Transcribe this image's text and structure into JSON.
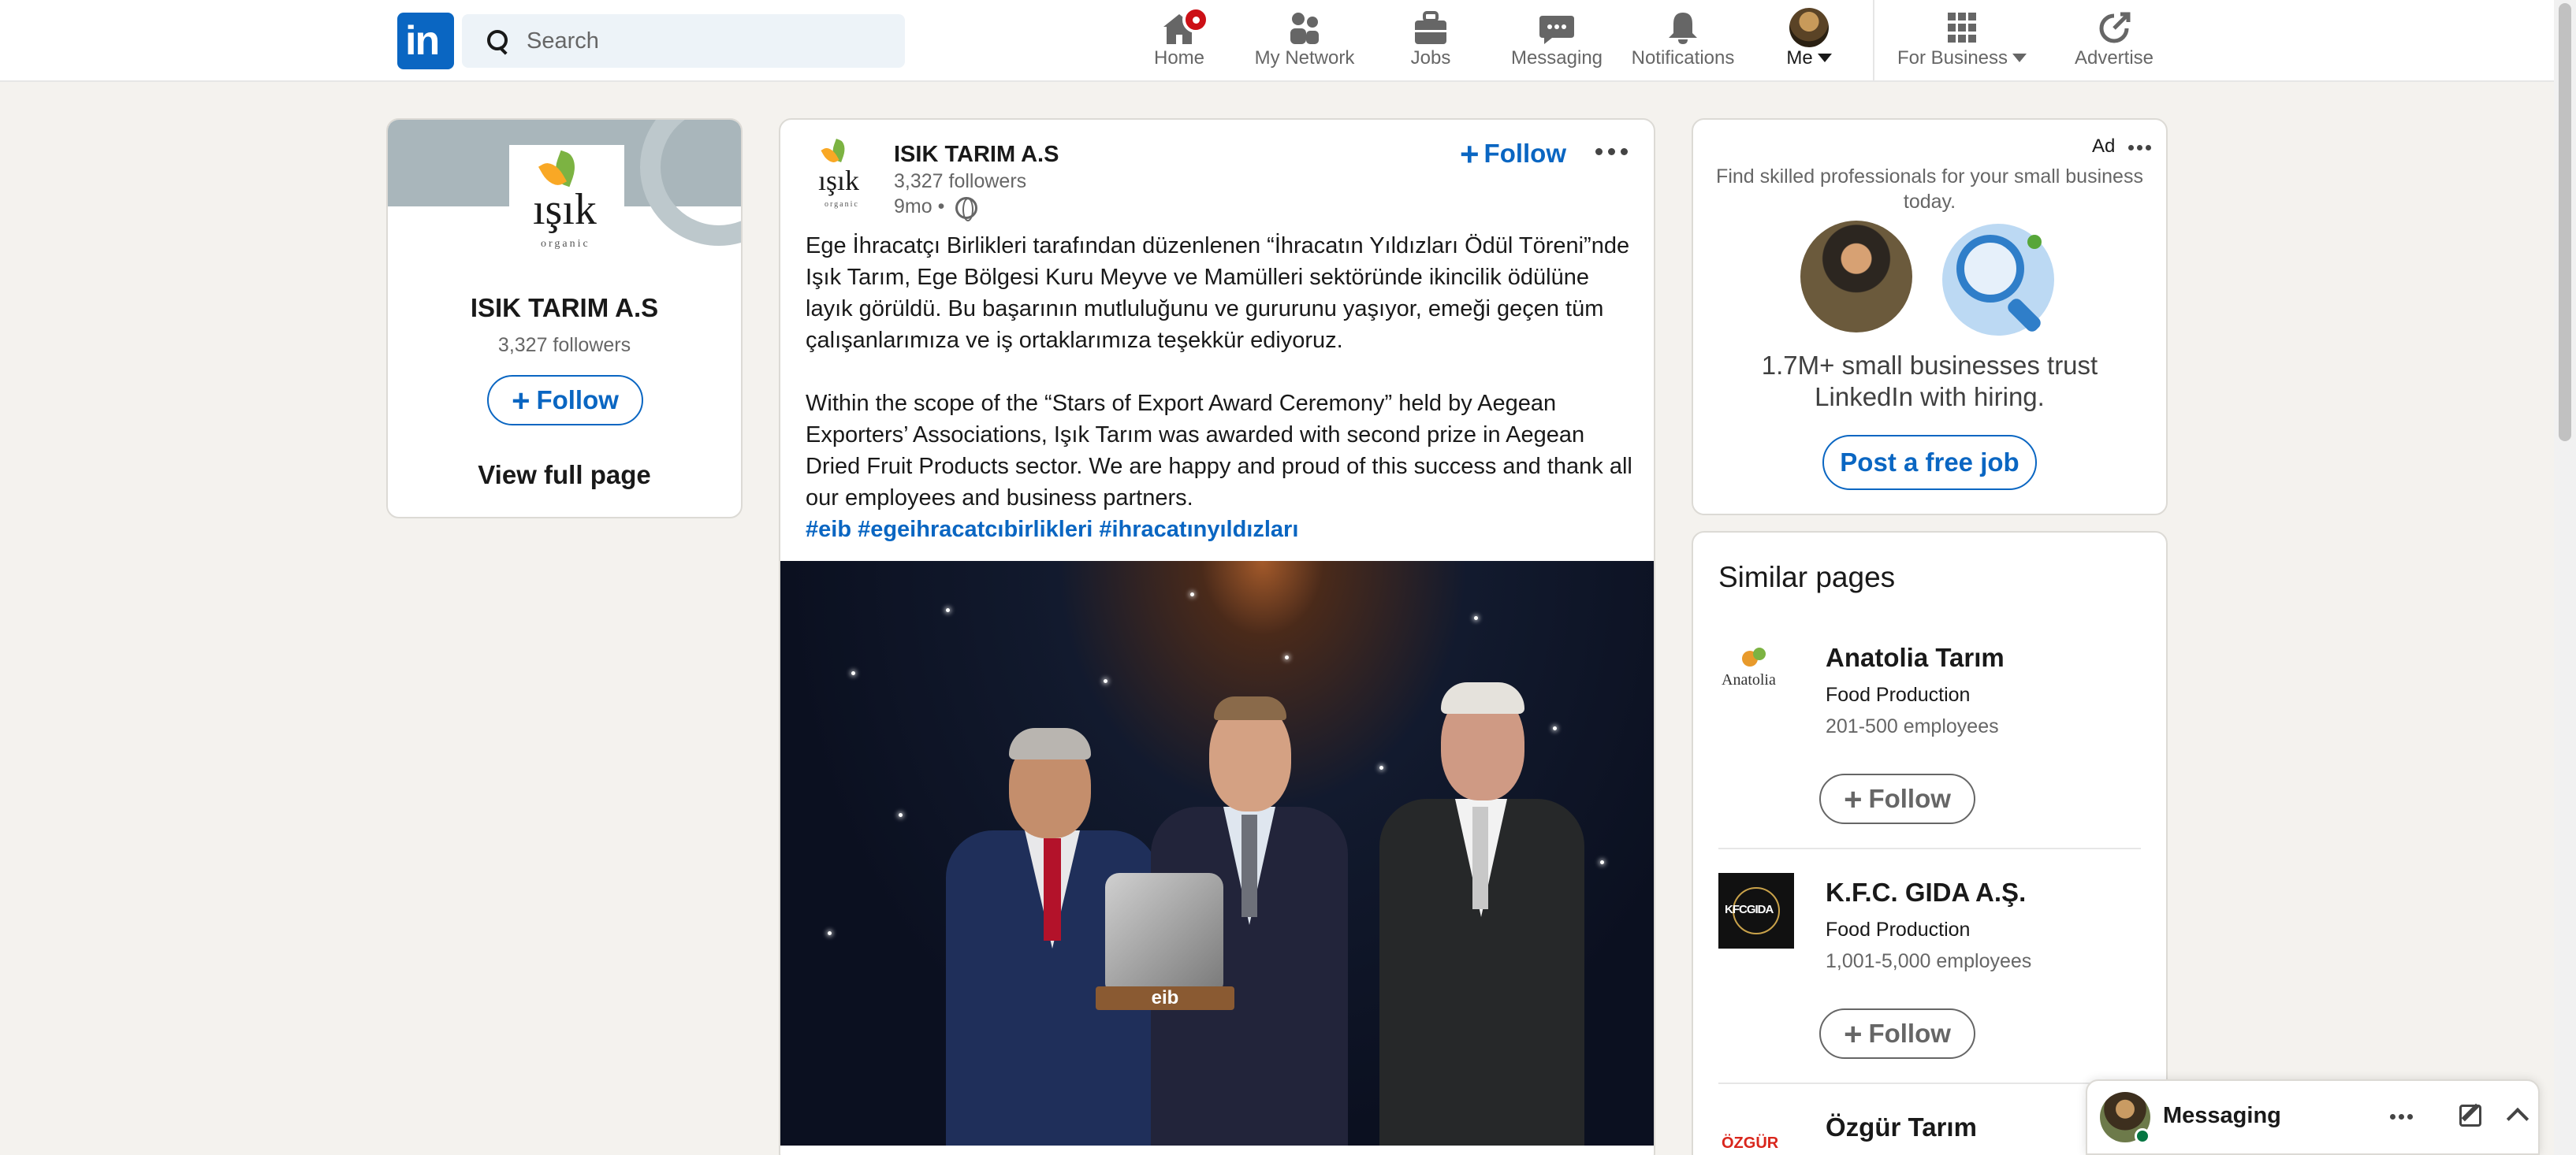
{
  "nav": {
    "logo_text": "in",
    "search_placeholder": "Search",
    "items": [
      {
        "label": "Home",
        "icon": "home-icon"
      },
      {
        "label": "My Network",
        "icon": "people-icon"
      },
      {
        "label": "Jobs",
        "icon": "briefcase-icon"
      },
      {
        "label": "Messaging",
        "icon": "chat-icon"
      },
      {
        "label": "Notifications",
        "icon": "bell-icon"
      },
      {
        "label": "Me",
        "icon": "avatar"
      },
      {
        "label": "For Business",
        "icon": "grid-icon"
      },
      {
        "label": "Advertise",
        "icon": "advertise-icon"
      }
    ]
  },
  "company_card": {
    "logo_word": "ışık",
    "logo_sub": "organic",
    "name": "ISIK TARIM A.S",
    "followers": "3,327 followers",
    "follow_label": "Follow",
    "view_full_page": "View full page"
  },
  "post": {
    "author": "ISIK TARIM A.S",
    "followers": "3,327 followers",
    "time": "9mo •",
    "follow_label": "Follow",
    "paragraph_tr": "Ege İhracatçı Birlikleri tarafından düzenlenen “İhracatın Yıldızları Ödül Töreni”nde Işık Tarım, Ege Bölgesi Kuru Meyve ve Mamülleri sektöründe ikincilik ödülüne layık görüldü. Bu başarının mutluluğunu ve gururunu yaşıyor, emeği geçen tüm çalışanlarımıza ve iş ortaklarımıza teşekkür ediyoruz.",
    "paragraph_en": "Within the scope of the “Stars of Export Award Ceremony” held by Aegean Exporters’ Associations, Işık Tarım was awarded with second prize in Aegean Dried Fruit Products sector. We are happy and proud of this success and thank all our employees and business partners.",
    "hashtags": "#eib #egeihracatcıbirlikleri #ihracatınyıldızları",
    "photo_caption": "eib"
  },
  "ad": {
    "label": "Ad",
    "text": "Find skilled professionals for your small business today.",
    "trust": "1.7M+ small businesses trust LinkedIn with hiring.",
    "button": "Post a free job"
  },
  "similar": {
    "title": "Similar pages",
    "pages": [
      {
        "name": "Anatolia Tarım",
        "industry": "Food Production",
        "size": "201-500 employees",
        "follow": "Follow",
        "logo_text": "Anatolia"
      },
      {
        "name": "K.F.C. GIDA A.Ş.",
        "industry": "Food Production",
        "size": "1,001-5,000 employees",
        "follow": "Follow",
        "logo_text": "KFCGIDA"
      },
      {
        "name": "Özgür Tarım",
        "logo_text": "ÖZGÜR"
      }
    ]
  },
  "messaging": {
    "label": "Messaging"
  },
  "colors": {
    "brand": "#0a66c2",
    "notification": "#cc1016",
    "online": "#057642"
  }
}
